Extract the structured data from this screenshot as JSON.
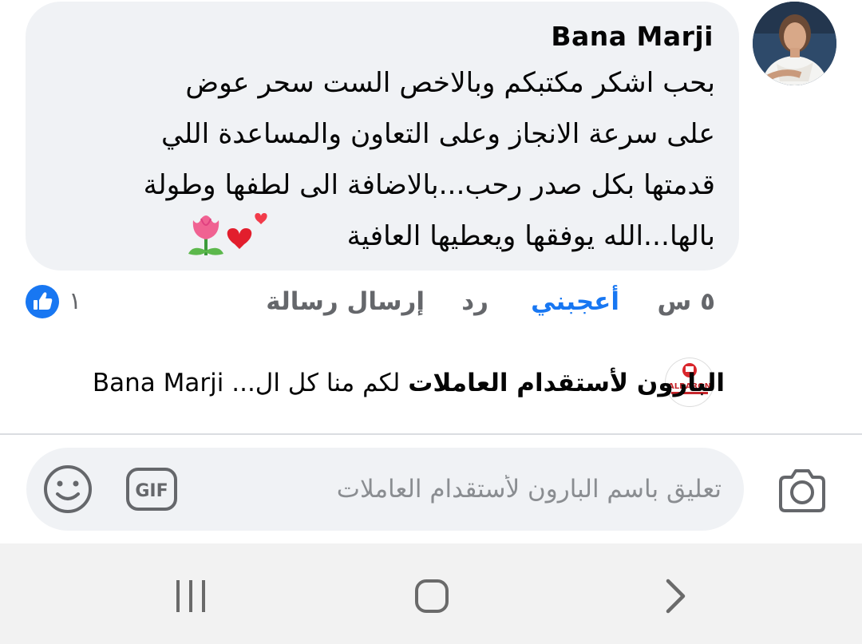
{
  "comment": {
    "author": "Bana Marji",
    "text_lines": [
      "بحب اشكر مكتبكم وبالاخص الست سحر عوض",
      "على سرعة الانجاز وعلى التعاون والمساعدة اللي",
      "قدمتها بكل صدر رحب...بالاضافة الى لطفها وطولة",
      "بالها...الله يوفقها  ويعطيها العافية"
    ],
    "emojis": [
      "tulip-emoji",
      "two-hearts-emoji"
    ],
    "actions": {
      "time": "٥ س",
      "like": "أعجبني",
      "reply": "رد",
      "send_message": "إرسال رسالة"
    },
    "reactions": {
      "icon": "like-icon",
      "count": "١"
    }
  },
  "reply_preview": {
    "page_name": "البارون لأستقدام العاملات",
    "snippet": "لكم منا كل ال...",
    "mention": "Bana Marji",
    "logo_text": "ALBARON"
  },
  "composer": {
    "placeholder": "تعليق باسم البارون لأستقدام العاملات",
    "gif_label": "GIF",
    "icons": [
      "camera-icon",
      "gif-icon",
      "emoji-icon"
    ]
  },
  "navbar": {
    "icons": [
      "recent-apps-icon",
      "home-icon",
      "back-icon"
    ]
  },
  "colors": {
    "bubble": "#f0f2f5",
    "like_blue": "#1877f2",
    "secondary_text": "#65676b",
    "navbar": "#f2f2f2"
  }
}
